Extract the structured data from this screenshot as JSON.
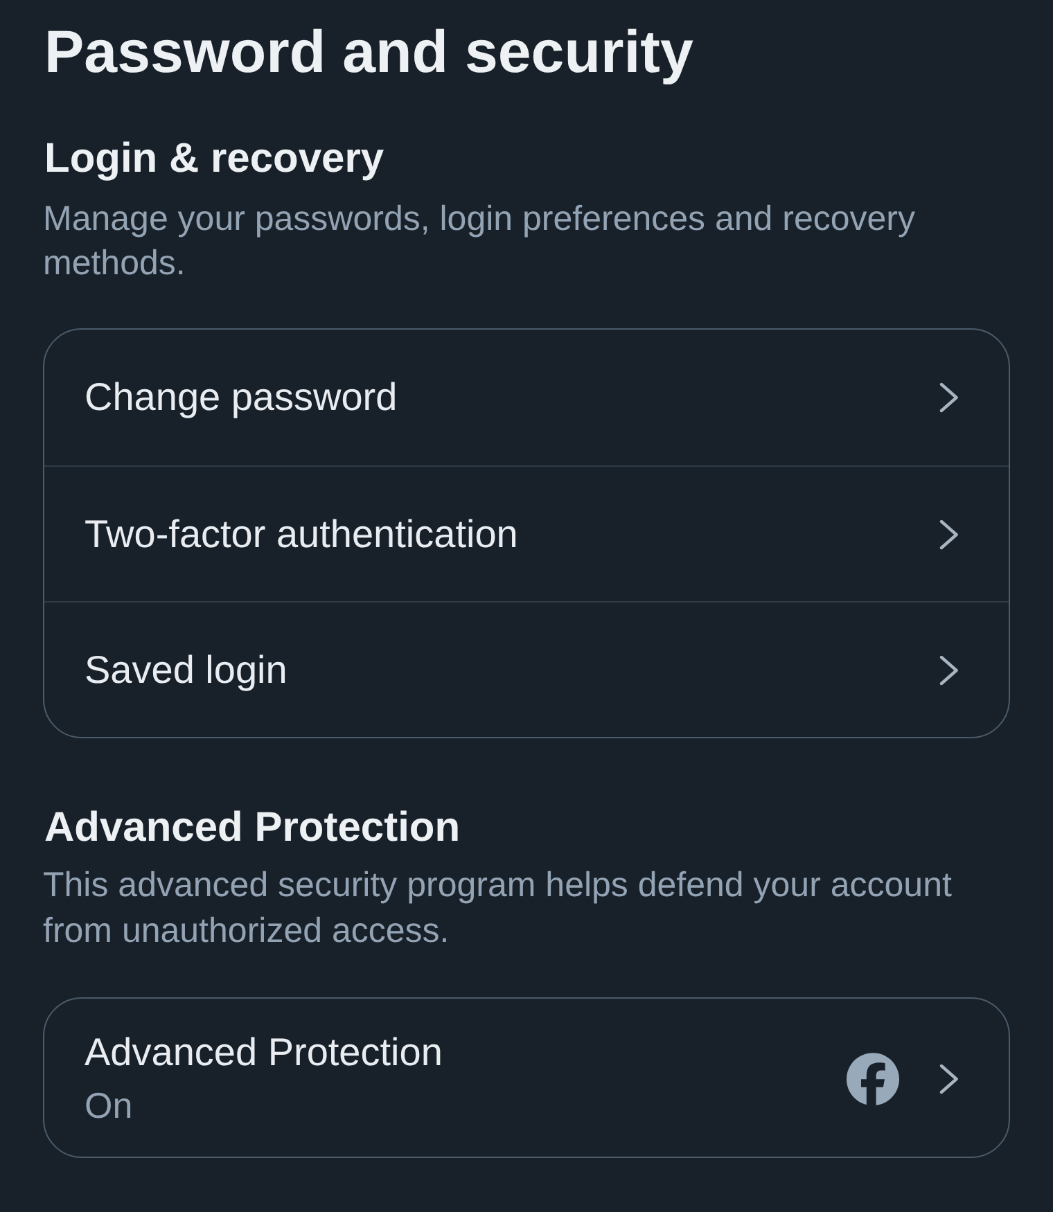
{
  "page_title": "Password and security",
  "sections": [
    {
      "heading": "Login & recovery",
      "description": "Manage your passwords, login preferences and recovery methods.",
      "items": [
        {
          "kind": "link",
          "label": "Change password"
        },
        {
          "kind": "link",
          "label": "Two-factor authentication"
        },
        {
          "kind": "link",
          "label": "Saved login"
        }
      ]
    },
    {
      "heading": "Advanced Protection",
      "description": "This advanced security program helps defend your account from unauthorized access.",
      "items": [
        {
          "kind": "account_link",
          "label": "Advanced Protection",
          "status": "On"
        }
      ]
    }
  ]
}
